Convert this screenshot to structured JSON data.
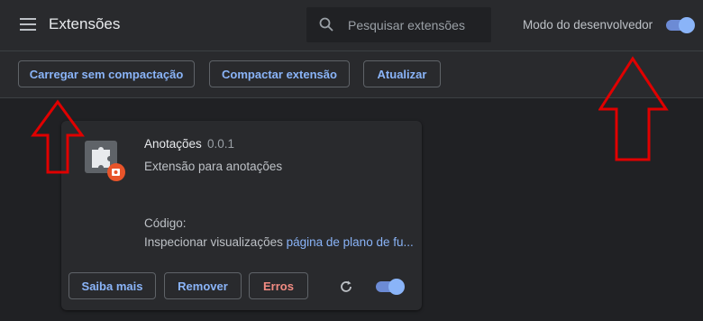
{
  "header": {
    "title": "Extensões",
    "search_placeholder": "Pesquisar extensões",
    "devmode_label": "Modo do desenvolvedor",
    "devmode_on": true
  },
  "toolbar": {
    "load_unpacked": "Carregar sem compactação",
    "pack": "Compactar extensão",
    "update": "Atualizar"
  },
  "extension": {
    "name": "Anotações",
    "version": "0.0.1",
    "description": "Extensão para anotações",
    "code_label": "Código:",
    "inspect_label": "Inspecionar visualizações",
    "inspect_link": "página de plano de fu...",
    "details_button": "Saiba mais",
    "remove_button": "Remover",
    "errors_button": "Erros",
    "enabled": true
  },
  "colors": {
    "accent": "#8ab4f8",
    "error": "#f28b82",
    "arrow": "#e00000"
  }
}
